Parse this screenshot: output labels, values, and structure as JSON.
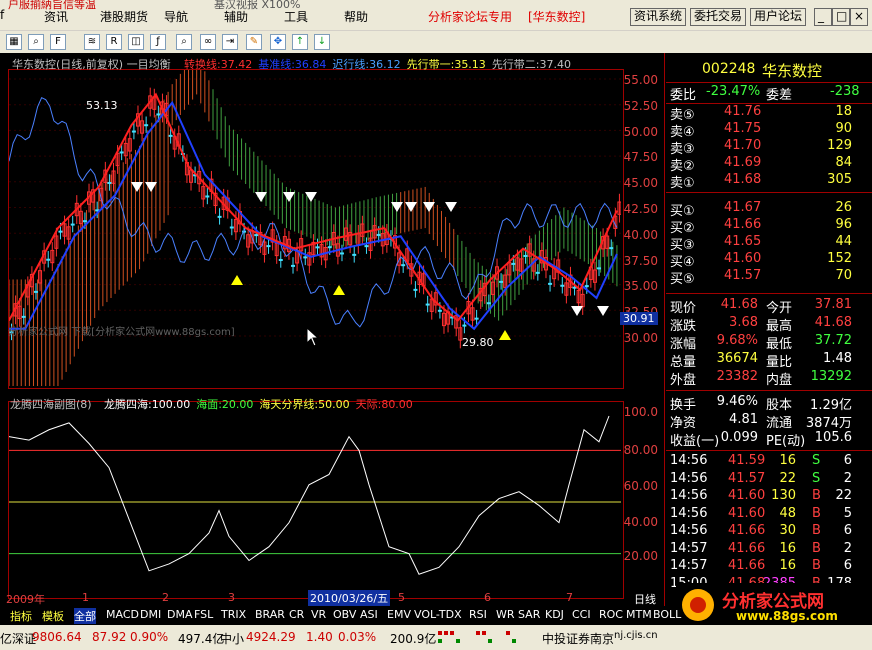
{
  "menu": {
    "top_clip": "户服揃納旨信等温",
    "items": [
      "资讯",
      "港股期货",
      "导航",
      "辅助",
      "工具",
      "帮助"
    ],
    "top_clip2": "基汉视报 X100%",
    "forum": "分析家论坛专用",
    "stock_tag": "[华东数控]",
    "buttons": [
      "资讯系统",
      "委托交易",
      "用户论坛"
    ]
  },
  "chart": {
    "title": "华东数控(日线,前复权) 一目均衡",
    "legend": [
      {
        "text": "转换线:37.42",
        "color": "#ff3030"
      },
      {
        "text": "基准线:36.84",
        "color": "#2040ff"
      },
      {
        "text": "迟行线:36.12",
        "color": "#4aa0ff"
      },
      {
        "text": "先行带一:35.13",
        "color": "#ffff40"
      },
      {
        "text": "先行带二:37.40",
        "color": "#c0c0c0"
      }
    ],
    "price_ticks": [
      "55.00",
      "52.50",
      "50.00",
      "47.50",
      "45.00",
      "42.50",
      "40.00",
      "37.50",
      "35.00",
      "32.50",
      "30.00"
    ],
    "high_label": "53.13",
    "low_label": "29.80",
    "current_price": "30.91",
    "watermark": "分析家公式网 下载[分析家公式网www.88gs.com]"
  },
  "sub_chart": {
    "title": "龙腾四海副图(8)",
    "legend": [
      {
        "text": "龙腾四海:100.00",
        "color": "#ffffff"
      },
      {
        "text": "海面:20.00",
        "color": "#40ff40"
      },
      {
        "text": "海天分界线:50.00",
        "color": "#ffff40"
      },
      {
        "text": "天际:80.00",
        "color": "#ff3030"
      }
    ],
    "ticks": [
      "100.0",
      "80.00",
      "60.00",
      "40.00",
      "20.00"
    ]
  },
  "x_axis": {
    "year": "2009年",
    "months": [
      "1",
      "2",
      "3",
      "4",
      "5",
      "6",
      "7"
    ],
    "date_cursor": "2010/03/26/五",
    "period": "日线"
  },
  "quote": {
    "code": "002248",
    "name": "华东数控",
    "weibi_label": "委比",
    "weibi": "-23.47%",
    "weicha_label": "委差",
    "weicha": "-238",
    "sell": [
      {
        "label": "卖⑤",
        "price": "41.76",
        "vol": "18"
      },
      {
        "label": "卖④",
        "price": "41.75",
        "vol": "90"
      },
      {
        "label": "卖③",
        "price": "41.70",
        "vol": "129"
      },
      {
        "label": "卖②",
        "price": "41.69",
        "vol": "84"
      },
      {
        "label": "卖①",
        "price": "41.68",
        "vol": "305"
      }
    ],
    "buy": [
      {
        "label": "买①",
        "price": "41.67",
        "vol": "26"
      },
      {
        "label": "买②",
        "price": "41.66",
        "vol": "96"
      },
      {
        "label": "买③",
        "price": "41.65",
        "vol": "44"
      },
      {
        "label": "买④",
        "price": "41.60",
        "vol": "152"
      },
      {
        "label": "买⑤",
        "price": "41.57",
        "vol": "70"
      }
    ],
    "stats": [
      {
        "l1": "现价",
        "v1": "41.68",
        "c1": "#ff4040",
        "l2": "今开",
        "v2": "37.81",
        "c2": "#ff4040"
      },
      {
        "l1": "涨跌",
        "v1": "3.68",
        "c1": "#ff4040",
        "l2": "最高",
        "v2": "41.68",
        "c2": "#ff4040"
      },
      {
        "l1": "涨幅",
        "v1": "9.68%",
        "c1": "#ff4040",
        "l2": "最低",
        "v2": "37.72",
        "c2": "#40ff40"
      },
      {
        "l1": "总量",
        "v1": "36674",
        "c1": "#ffff40",
        "l2": "量比",
        "v2": "1.48",
        "c2": "#ffffff"
      },
      {
        "l1": "外盘",
        "v1": "23382",
        "c1": "#ff4040",
        "l2": "内盘",
        "v2": "13292",
        "c2": "#40ff40"
      }
    ],
    "stats2": [
      {
        "l1": "换手",
        "v1": "9.46%",
        "l2": "股本",
        "v2": "1.29亿"
      },
      {
        "l1": "净资",
        "v1": "4.81",
        "l2": "流通",
        "v2": "3874万"
      },
      {
        "l1": "收益(一)",
        "v1": "0.099",
        "l2": "PE(动)",
        "v2": "105.6"
      }
    ],
    "ticks": [
      {
        "t": "14:56",
        "p": "41.59",
        "v": "16",
        "bs": "S",
        "n": "6"
      },
      {
        "t": "14:56",
        "p": "41.57",
        "v": "22",
        "bs": "S",
        "n": "2"
      },
      {
        "t": "14:56",
        "p": "41.60",
        "v": "130",
        "bs": "B",
        "n": "22"
      },
      {
        "t": "14:56",
        "p": "41.60",
        "v": "48",
        "bs": "B",
        "n": "5"
      },
      {
        "t": "14:56",
        "p": "41.66",
        "v": "30",
        "bs": "B",
        "n": "6"
      },
      {
        "t": "14:57",
        "p": "41.66",
        "v": "16",
        "bs": "B",
        "n": "2"
      },
      {
        "t": "14:57",
        "p": "41.66",
        "v": "16",
        "bs": "B",
        "n": "6"
      },
      {
        "t": "15:00",
        "p": "41.68",
        "v": "2385",
        "bs": "B",
        "n": "178"
      }
    ]
  },
  "tabs": [
    "指标",
    "模板",
    "全部",
    "MACD",
    "DMI",
    "DMA",
    "FSL",
    "TRIX",
    "BRAR",
    "CR",
    "VR",
    "OBV",
    "ASI",
    "EMV",
    "VOL-TDX",
    "RSI",
    "WR",
    "SAR",
    "KDJ",
    "CCI",
    "ROC",
    "MTM",
    "BOLL"
  ],
  "statusbar": {
    "sz_label": "亿深证",
    "sz_value": "9806.64",
    "sz_change": "87.92",
    "sz_pct": "0.90%",
    "sz_amount": "497.4亿",
    "zx_label": "中小",
    "zx_value": "4924.29",
    "zx_change": "1.40",
    "zx_pct": "0.03%",
    "zx_amount": "200.9亿",
    "broker": "中投证券南京",
    "site": "nj.cjis.cn",
    "logo_text": "分析家公式网",
    "logo_url": "www.88gs.com"
  }
}
